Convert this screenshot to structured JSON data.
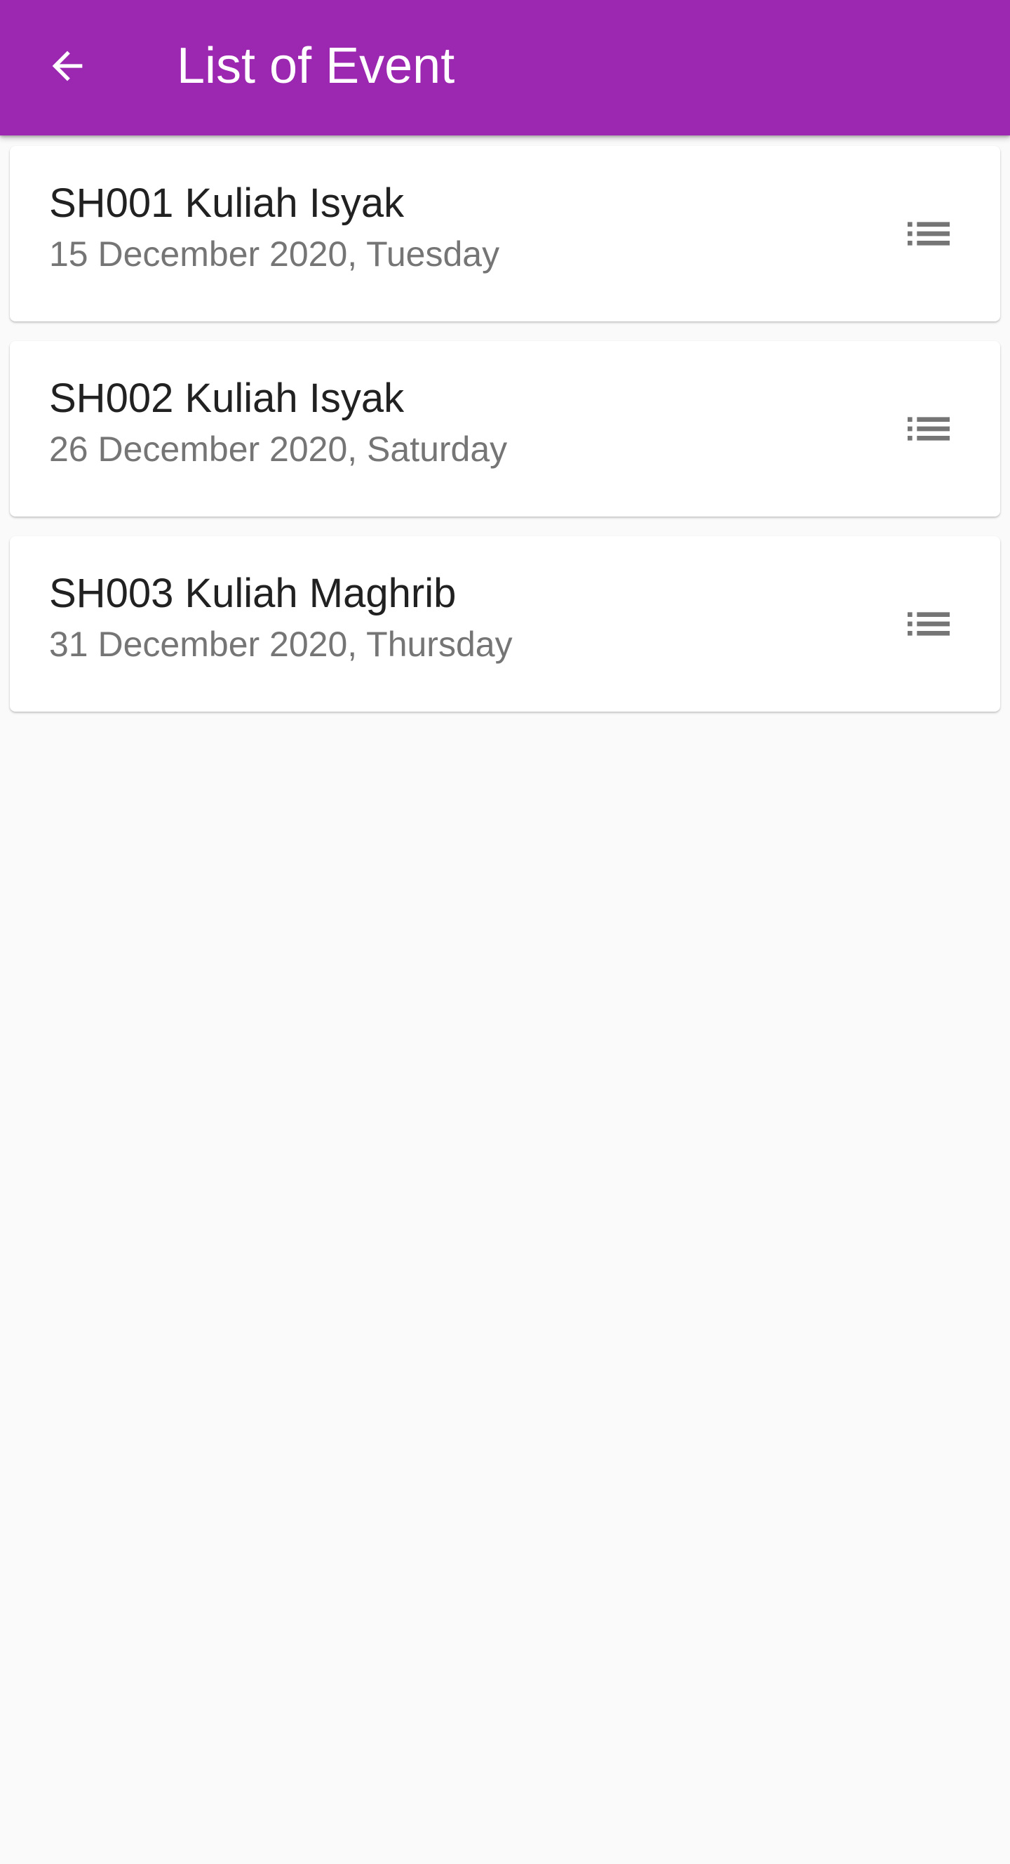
{
  "app_bar": {
    "title": "List of Event",
    "color": "#9c27b0",
    "back_icon": "arrow-back-icon"
  },
  "events": [
    {
      "title": "SH001 Kuliah Isyak",
      "date": "15 December 2020, Tuesday",
      "icon": "list-icon"
    },
    {
      "title": "SH002 Kuliah Isyak",
      "date": "26 December 2020, Saturday",
      "icon": "list-icon"
    },
    {
      "title": "SH003 Kuliah Maghrib",
      "date": "31 December 2020, Thursday",
      "icon": "list-icon"
    }
  ]
}
